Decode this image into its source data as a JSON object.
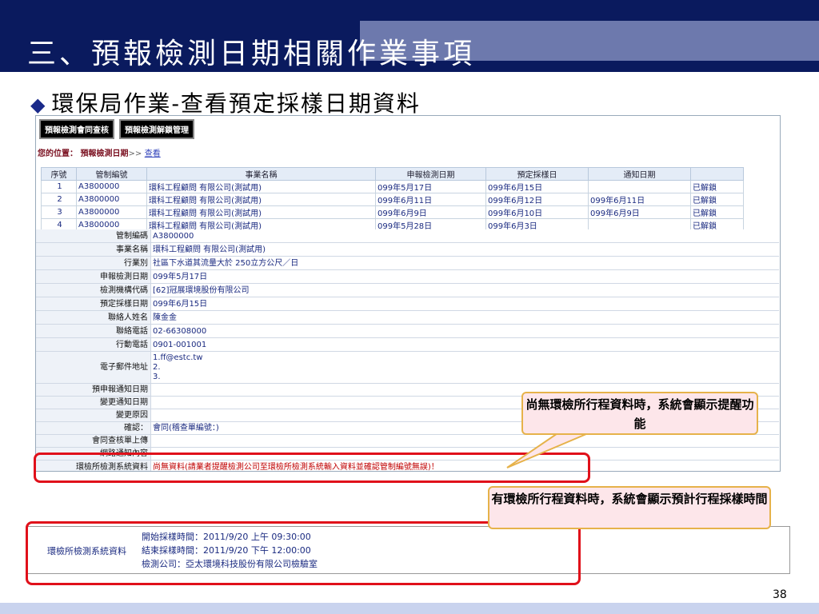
{
  "slide": {
    "title": "三、預報檢測日期相關作業事項",
    "subtitle": "環保局作業-查看預定採樣日期資料",
    "page_number": "38"
  },
  "app": {
    "tabs": [
      "預報檢測會同查核",
      "預報檢測解鎖管理"
    ],
    "breadcrumb": {
      "label": "您的位置：",
      "current": "預報檢測日期",
      "arrow": ">>",
      "link": "查看"
    },
    "grid": {
      "headers": [
        "序號",
        "管制編號",
        "事業名稱",
        "申報檢測日期",
        "預定採樣日",
        "通知日期",
        ""
      ],
      "rows": [
        [
          "1",
          "A3800000",
          "環科工程顧問 有限公司(測試用)",
          "099年5月17日",
          "099年6月15日",
          "",
          "已解鎖"
        ],
        [
          "2",
          "A3800000",
          "環科工程顧問 有限公司(測試用)",
          "099年6月11日",
          "099年6月12日",
          "099年6月11日",
          "已解鎖"
        ],
        [
          "3",
          "A3800000",
          "環科工程顧問 有限公司(測試用)",
          "099年6月9日",
          "099年6月10日",
          "099年6月9日",
          "已解鎖"
        ],
        [
          "4",
          "A3800000",
          "環科工程顧問 有限公司(測試用)",
          "099年5月28日",
          "099年6月3日",
          "",
          "已解鎖"
        ]
      ]
    },
    "detail": {
      "fields": [
        {
          "label": "管制編碼",
          "value": "A3800000"
        },
        {
          "label": "事業名稱",
          "value": "環科工程顧問 有限公司(測試用)"
        },
        {
          "label": "行業別",
          "value": "社區下水道其流量大於 250立方公尺／日"
        },
        {
          "label": "申報檢測日期",
          "value": "099年5月17日"
        },
        {
          "label": "檢測機構代碼",
          "value": "[62]冠展環境股份有限公司"
        },
        {
          "label": "預定採樣日期",
          "value": "099年6月15日"
        },
        {
          "label": "聯絡人姓名",
          "value": "陳金金"
        },
        {
          "label": "聯絡電話",
          "value": "02-66308000"
        },
        {
          "label": "行動電話",
          "value": "0901-001001"
        }
      ],
      "email": {
        "label": "電子郵件地址",
        "lines": [
          "1.ff@estc.tw",
          "2.",
          "3."
        ]
      },
      "fields2": [
        {
          "label": "預申報通知日期",
          "value": ""
        },
        {
          "label": "變更通知日期",
          "value": ""
        },
        {
          "label": "變更原因",
          "value": ""
        },
        {
          "label": "確認：",
          "value": "會同(稽查單編號：)"
        },
        {
          "label": "會同查核單上傳",
          "value": ""
        },
        {
          "label": "網路通知內容",
          "value": ""
        }
      ],
      "system_row": {
        "label": "環檢所檢測系統資料",
        "value": "尚無資料(請業者提醒檢測公司至環檢所檢測系統輸入資料並確認管制編號無誤)！"
      }
    }
  },
  "callouts": {
    "no_data": "尚無環檢所行程資料時，系統會顯示提醒功能",
    "has_data": "有環檢所行程資料時，系統會顯示預計行程採樣時間"
  },
  "panel2": {
    "label": "環檢所檢測系統資料",
    "lines": [
      "開始採樣時間：2011/9/20 上午 09:30:00",
      "結束採樣時間：2011/9/20 下午 12:00:00",
      "檢測公司：亞太環境科技股份有限公司檢驗室"
    ]
  },
  "colors": {
    "title_bar": "#0a1a5e",
    "title_accent": "#6d79ad",
    "highlight_box": "#e0101a",
    "callout_fill": "#fde6ea",
    "callout_border": "#e6b24a",
    "value_text": "#1a2a80",
    "warning_text": "#c00000"
  }
}
